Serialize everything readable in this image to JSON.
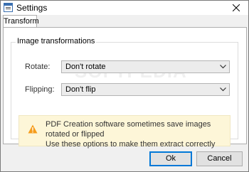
{
  "window": {
    "title": "Settings",
    "icon": "settings-window-icon",
    "close_icon": "close-icon"
  },
  "tabs": [
    {
      "label": "Transform"
    }
  ],
  "group": {
    "title": "Image transformations",
    "rotate": {
      "label": "Rotate:",
      "value": "Don't rotate"
    },
    "flipping": {
      "label": "Flipping:",
      "value": "Don't flip"
    },
    "warning": {
      "icon": "warning-icon",
      "line1": "PDF Creation software sometimes save images rotated or flipped",
      "line2": "Use these options to make them extract correctly",
      "background": "#fdf6d8",
      "icon_color": "#f59c1b"
    }
  },
  "watermark": "SOFTPEDIA",
  "buttons": {
    "ok": "Ok",
    "cancel": "Cancel"
  },
  "colors": {
    "accent": "#0078d7"
  }
}
